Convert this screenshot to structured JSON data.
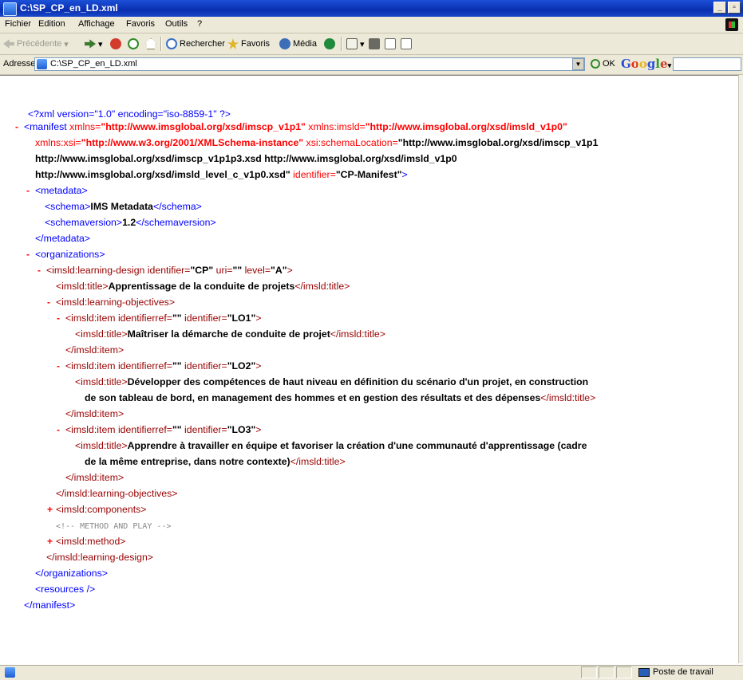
{
  "window": {
    "title": "C:\\SP_CP_en_LD.xml"
  },
  "menu": [
    {
      "label": "Fichier"
    },
    {
      "label": "Edition"
    },
    {
      "label": "Affichage"
    },
    {
      "label": "Favoris"
    },
    {
      "label": "Outils"
    },
    {
      "label": "?"
    }
  ],
  "toolbar": {
    "back": "Précédente",
    "search": "Rechercher",
    "favorites": "Favoris",
    "media": "Média"
  },
  "address": {
    "label": "Adresse",
    "url": "C:\\SP_CP_en_LD.xml",
    "go": "OK",
    "google": "Google",
    "google_dropdown": "▾"
  },
  "xml": {
    "decl": "<?xml version=\"1.0\" encoding=\"iso-8859-1\" ?>",
    "manifest_open": "<manifest",
    "xmlns_attr": " xmlns=",
    "xmlns_val": "\"http://www.imsglobal.org/xsd/imscp_v1p1\"",
    "xmlns_imsld_attr": " xmlns:imsld=",
    "xmlns_imsld_val": "\"http://www.imsglobal.org/xsd/imsld_v1p0\"",
    "xmlns_xsi_attr": "xmlns:xsi=",
    "xmlns_xsi_val": "\"http://www.w3.org/2001/XMLSchema-instance\"",
    "schemaloc_attr": " xsi:schemaLocation=",
    "schemaloc_val_1": "\"http://www.imsglobal.org/xsd/imscp_v1p1",
    "schemaloc_val_2": "http://www.imsglobal.org/xsd/imscp_v1p1p3.xsd http://www.imsglobal.org/xsd/imsld_v1p0",
    "schemaloc_val_3": "http://www.imsglobal.org/xsd/imsld_level_c_v1p0.xsd\"",
    "identifier_attr": " identifier=",
    "identifier_val": "\"CP-Manifest\"",
    "metadata_open": "<metadata>",
    "schema_open": "<schema>",
    "schema_val": "IMS Metadata",
    "schema_close": "</schema>",
    "schemaversion_open": "<schemaversion>",
    "schemaversion_val": "1.2",
    "schemaversion_close": "</schemaversion>",
    "metadata_close": "</metadata>",
    "organizations_open": "<organizations>",
    "ld_open_a": "<imsld:learning-design identifier=",
    "ld_id_val": "\"CP\"",
    "ld_uri_attr": " uri=",
    "ld_uri_val": "\"\"",
    "ld_level_attr": " level=",
    "ld_level_val": "\"A\"",
    "ld_open_end": ">",
    "title_open": "<imsld:title>",
    "title_close": "</imsld:title>",
    "ld_title": "Apprentissage de la conduite de projets",
    "lo_open": "<imsld:learning-objectives>",
    "item_open_a": "<imsld:item identifierref=",
    "item_ref_val": "\"\"",
    "item_id_attr": " identifier=",
    "lo1_id": "\"LO1\"",
    "lo2_id": "\"LO2\"",
    "lo3_id": "\"LO3\"",
    "item_open_end": ">",
    "lo1_title": "Maîtriser la démarche de conduite de projet",
    "lo2_title_1": "Développer des compétences de haut niveau en définition du scénario d'un projet, en construction",
    "lo2_title_2": "de son tableau de bord, en management des hommes et en gestion des résultats et des dépenses",
    "lo3_title_1": "Apprendre à travailler en équipe et favoriser la création d'une communauté d'apprentissage (cadre",
    "lo3_title_2": "de la même entreprise, dans notre contexte)",
    "item_close": "</imsld:item>",
    "lo_close": "</imsld:learning-objectives>",
    "components": "<imsld:components>",
    "comment": "<!-- METHOD AND PLAY -->",
    "method": "<imsld:method>",
    "ld_close": "</imsld:learning-design>",
    "organizations_close": "</organizations>",
    "resources": "<resources />",
    "manifest_close": "</manifest>",
    "minus": "-",
    "plus": "+"
  },
  "status": {
    "zone": "Poste de travail"
  }
}
